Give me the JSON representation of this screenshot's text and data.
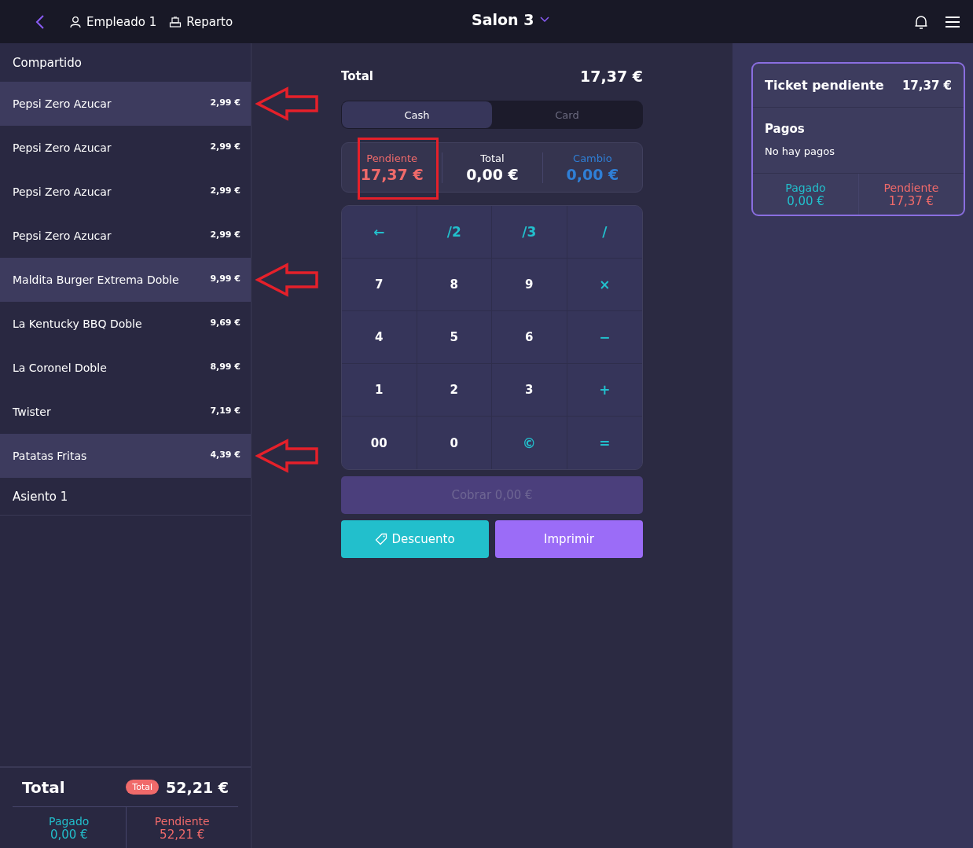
{
  "header": {
    "employee": "Empleado 1",
    "mode": "Reparto",
    "room": "Salon 3"
  },
  "order": {
    "group": "Compartido",
    "items": [
      {
        "name": "Pepsi Zero Azucar",
        "price": "2,99 €",
        "selected": true,
        "annotated": true
      },
      {
        "name": "Pepsi Zero Azucar",
        "price": "2,99 €",
        "selected": false,
        "annotated": false
      },
      {
        "name": "Pepsi Zero Azucar",
        "price": "2,99 €",
        "selected": false,
        "annotated": false
      },
      {
        "name": "Pepsi Zero Azucar",
        "price": "2,99 €",
        "selected": false,
        "annotated": false
      },
      {
        "name": "Maldita Burger Extrema Doble",
        "price": "9,99 €",
        "selected": true,
        "annotated": true
      },
      {
        "name": "La Kentucky BBQ Doble",
        "price": "9,69 €",
        "selected": false,
        "annotated": false
      },
      {
        "name": "La Coronel Doble",
        "price": "8,99 €",
        "selected": false,
        "annotated": false
      },
      {
        "name": "Twister",
        "price": "7,19 €",
        "selected": false,
        "annotated": false
      },
      {
        "name": "Patatas Fritas",
        "price": "4,39 €",
        "selected": true,
        "annotated": true
      }
    ],
    "seat": "Asiento 1",
    "total_label": "Total",
    "total_badge": "Total",
    "total": "52,21 €",
    "paid_label": "Pagado",
    "paid": "0,00 €",
    "pending_label": "Pendiente",
    "pending": "52,21 €"
  },
  "payment": {
    "total_label": "Total",
    "total": "17,37 €",
    "tabs": [
      {
        "label": "Cash",
        "selected": true
      },
      {
        "label": "Card",
        "selected": false
      }
    ],
    "stats": [
      {
        "label": "Pendiente",
        "value": "17,37 €",
        "color": "#f06a6a",
        "annotated": true
      },
      {
        "label": "Total",
        "value": "0,00 €",
        "color": "#ffffff",
        "annotated": false
      },
      {
        "label": "Cambio",
        "value": "0,00 €",
        "color": "#2f7fd6",
        "annotated": false
      }
    ],
    "keys": [
      {
        "label": "←",
        "kind": "operator"
      },
      {
        "label": "/2",
        "kind": "operator"
      },
      {
        "label": "/3",
        "kind": "operator"
      },
      {
        "label": "/",
        "kind": "operator"
      },
      {
        "label": "7",
        "kind": "digit"
      },
      {
        "label": "8",
        "kind": "digit"
      },
      {
        "label": "9",
        "kind": "digit"
      },
      {
        "label": "×",
        "kind": "operator"
      },
      {
        "label": "4",
        "kind": "digit"
      },
      {
        "label": "5",
        "kind": "digit"
      },
      {
        "label": "6",
        "kind": "digit"
      },
      {
        "label": "−",
        "kind": "operator"
      },
      {
        "label": "1",
        "kind": "digit"
      },
      {
        "label": "2",
        "kind": "digit"
      },
      {
        "label": "3",
        "kind": "digit"
      },
      {
        "label": "+",
        "kind": "operator"
      },
      {
        "label": "00",
        "kind": "digit"
      },
      {
        "label": "0",
        "kind": "digit"
      },
      {
        "label": "©",
        "kind": "operator"
      },
      {
        "label": "=",
        "kind": "operator"
      }
    ],
    "charge": {
      "label": "Cobrar 0,00 €",
      "disabled": true
    },
    "discount": "Descuento",
    "print": "Imprimir"
  },
  "ticket": {
    "title": "Ticket pendiente",
    "amount": "17,37 €",
    "payments_title": "Pagos",
    "payments_empty": "No hay pagos",
    "paid_label": "Pagado",
    "paid": "0,00 €",
    "pending_label": "Pendiente",
    "pending": "17,37 €"
  }
}
